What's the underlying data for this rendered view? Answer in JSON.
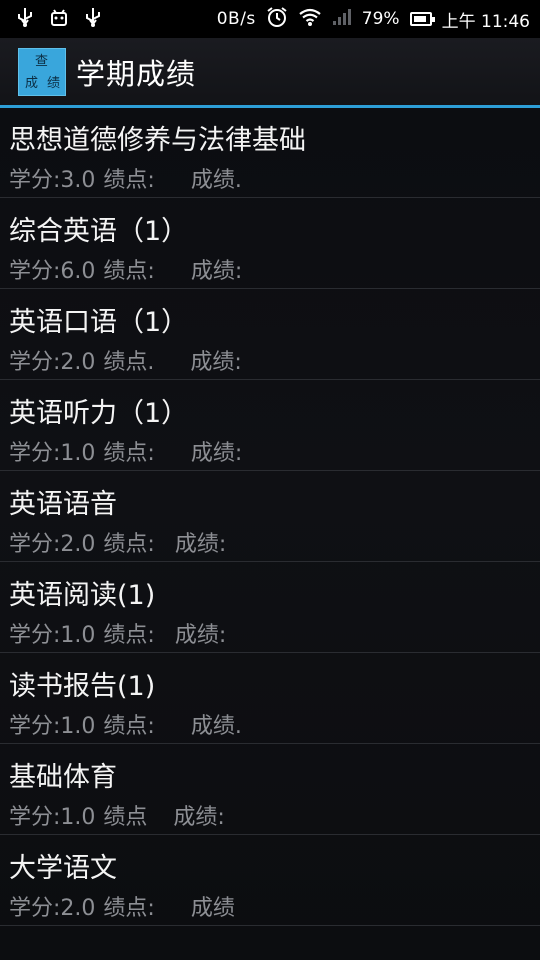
{
  "status_bar": {
    "net_speed": "0B/s",
    "battery_pct": "79%",
    "clock": "上午 11:46",
    "icons": [
      "usb-icon",
      "android-debug-icon",
      "usb-icon",
      "alarm-icon",
      "wifi-icon",
      "signal-icon",
      "battery-charging-icon"
    ]
  },
  "action_bar": {
    "icon_chars": [
      "查",
      "成",
      "绩"
    ],
    "title": "学期成绩"
  },
  "colors": {
    "accent": "#2d9fd8",
    "icon_bg": "#39a6dc"
  },
  "courses": [
    {
      "name": "思想道德修养与法律基础",
      "credit": "学分:3.0",
      "gpa": "绩点:",
      "score": "成绩."
    },
    {
      "name": "综合英语（1）",
      "credit": "学分:6.0",
      "gpa": "绩点:",
      "score": "成绩:"
    },
    {
      "name": "英语口语（1）",
      "credit": "学分:2.0",
      "gpa": "绩点.",
      "score": "成绩:"
    },
    {
      "name": "英语听力（1）",
      "credit": "学分:1.0",
      "gpa": "绩点:",
      "score": "成绩:"
    },
    {
      "name": "英语语音",
      "credit": "学分:2.0",
      "gpa": "绩点:",
      "score": "成绩:"
    },
    {
      "name": "英语阅读(1)",
      "credit": "学分:1.0",
      "gpa": "绩点:",
      "score": "成绩:"
    },
    {
      "name": "读书报告(1)",
      "credit": "学分:1.0",
      "gpa": "绩点:",
      "score": "成绩."
    },
    {
      "name": "基础体育",
      "credit": "学分:1.0",
      "gpa": "绩点",
      "score": "成绩:"
    },
    {
      "name": "大学语文",
      "credit": "学分:2.0",
      "gpa": "绩点:",
      "score": "成绩"
    }
  ]
}
